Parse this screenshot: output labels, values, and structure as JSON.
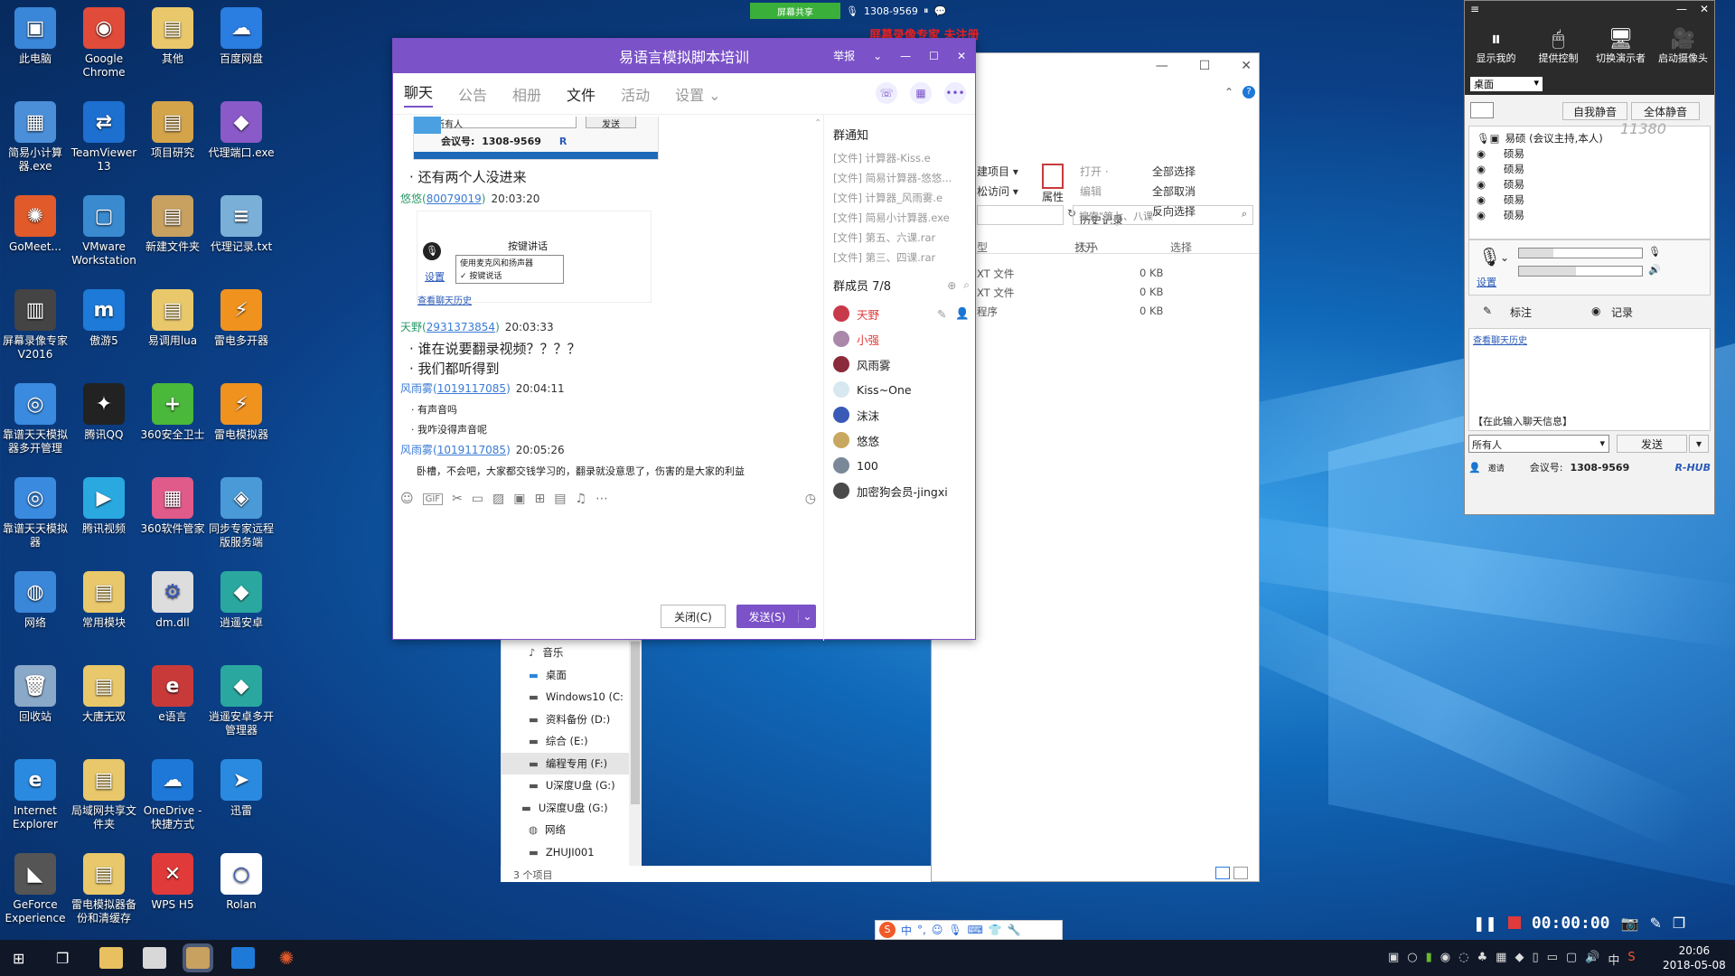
{
  "desktop": {
    "icons": [
      {
        "label": "此电脑",
        "color": "#3a86d8",
        "glyph": "▣"
      },
      {
        "label": "Google Chrome",
        "color": "#e04b3a",
        "glyph": "◉"
      },
      {
        "label": "其他",
        "color": "#e8c86a",
        "glyph": "▤"
      },
      {
        "label": "百度网盘",
        "color": "#2a7de1",
        "glyph": "☁"
      },
      {
        "label": "简易小计算器.exe",
        "color": "#4a8fd8",
        "glyph": "▦"
      },
      {
        "label": "TeamViewer 13",
        "color": "#1d6fd0",
        "glyph": "⇄"
      },
      {
        "label": "项目研究",
        "color": "#d4a44a",
        "glyph": "▤"
      },
      {
        "label": "代理端口.exe",
        "color": "#8a5ac8",
        "glyph": "◆"
      },
      {
        "label": "GoMeet...",
        "color": "#e05a2a",
        "glyph": "✺"
      },
      {
        "label": "VMware Workstation",
        "color": "#3a8ad0",
        "glyph": "▢"
      },
      {
        "label": "新建文件夹",
        "color": "#c8a060",
        "glyph": "▤"
      },
      {
        "label": "代理记录.txt",
        "color": "#7ab0d8",
        "glyph": "≡"
      },
      {
        "label": "屏幕录像专家V2016",
        "color": "#444",
        "glyph": "▥"
      },
      {
        "label": "傲游5",
        "color": "#1e7ad8",
        "glyph": "m"
      },
      {
        "label": "易调用lua",
        "color": "#e8c86a",
        "glyph": "▤"
      },
      {
        "label": "雷电多开器",
        "color": "#f0921e",
        "glyph": "⚡"
      },
      {
        "label": "靠谱天天模拟器多开管理",
        "color": "#3a8ae0",
        "glyph": "◎"
      },
      {
        "label": "腾讯QQ",
        "color": "#222",
        "glyph": "✦"
      },
      {
        "label": "360安全卫士",
        "color": "#4ab83a",
        "glyph": "+"
      },
      {
        "label": "雷电模拟器",
        "color": "#f0921e",
        "glyph": "⚡"
      },
      {
        "label": "靠谱天天模拟器",
        "color": "#3a8ae0",
        "glyph": "◎"
      },
      {
        "label": "腾讯视频",
        "color": "#2aa8e0",
        "glyph": "▶"
      },
      {
        "label": "360软件管家",
        "color": "#e05a8a",
        "glyph": "▦"
      },
      {
        "label": "同步专家远程版服务端",
        "color": "#4a9ad8",
        "glyph": "◈"
      },
      {
        "label": "网络",
        "color": "#3a86d8",
        "glyph": "◍"
      },
      {
        "label": "常用模块",
        "color": "#e8c86a",
        "glyph": "▤"
      },
      {
        "label": "dm.dll",
        "color": "#ddd",
        "glyph": "⚙"
      },
      {
        "label": "逍遥安卓",
        "color": "#2aa8a0",
        "glyph": "◆"
      },
      {
        "label": "回收站",
        "color": "#8aa8c8",
        "glyph": "🗑"
      },
      {
        "label": "大唐无双",
        "color": "#e8c86a",
        "glyph": "▤"
      },
      {
        "label": "e语言",
        "color": "#c83a3a",
        "glyph": "e"
      },
      {
        "label": "逍遥安卓多开管理器",
        "color": "#2aa8a0",
        "glyph": "◆"
      },
      {
        "label": "Internet Explorer",
        "color": "#2a8ae0",
        "glyph": "e"
      },
      {
        "label": "局域网共享文件夹",
        "color": "#e8c86a",
        "glyph": "▤"
      },
      {
        "label": "OneDrive - 快捷方式",
        "color": "#1e78d8",
        "glyph": "☁"
      },
      {
        "label": "迅雷",
        "color": "#2a8ae0",
        "glyph": "➤"
      },
      {
        "label": "GeForce Experience",
        "color": "#555",
        "glyph": "◣"
      },
      {
        "label": "雷电模拟器备份和清缓存",
        "color": "#e8c86a",
        "glyph": "▤"
      },
      {
        "label": "WPS H5",
        "color": "#e03a3a",
        "glyph": "✕"
      },
      {
        "label": "Rolan",
        "color": "#fff",
        "glyph": "○"
      }
    ]
  },
  "recorder_bar": {
    "status": "屏幕共享",
    "meeting_id": "1308-9569",
    "watermark": "屏幕录像专家 未注册"
  },
  "chat": {
    "title": "易语言模拟脚本培训",
    "title_actions": {
      "report": "举报"
    },
    "tabs": [
      "聊天",
      "公告",
      "相册",
      "文件",
      "活动",
      "设置"
    ],
    "active_tab": "聊天",
    "embedded_bar": {
      "audience": "所有人",
      "send": "发送",
      "meeting_label": "会议号:",
      "meeting_id": "1308-9569",
      "r": "R"
    },
    "messages": [
      {
        "type": "text",
        "text": "· 还有两个人没进来"
      },
      {
        "type": "header",
        "name": "悠悠",
        "id": "80079019",
        "time": "20:03:20"
      },
      {
        "type": "image",
        "title": "按键讲话",
        "opt1": "使用麦克风和扬声器",
        "opt2": "按键说话",
        "link": "设置",
        "history": "查看聊天历史"
      },
      {
        "type": "header",
        "name": "天野",
        "id": "2931373854",
        "time": "20:03:33"
      },
      {
        "type": "text",
        "text": "· 谁在说要翻录视频？？？？"
      },
      {
        "type": "text",
        "text": "· 我们都听得到"
      },
      {
        "type": "header",
        "name": "风雨雾",
        "id": "1019117085",
        "time": "20:04:11"
      },
      {
        "type": "small",
        "text": "· 有声音吗"
      },
      {
        "type": "small",
        "text": "· 我咋没得声音呢"
      },
      {
        "type": "header",
        "name": "风雨雾",
        "id": "1019117085",
        "time": "20:05:26"
      },
      {
        "type": "small",
        "text": "卧槽，不会吧，大家都交钱学习的，翻录就没意思了，伤害的是大家的利益"
      }
    ],
    "close_btn": "关闭(C)",
    "send_btn": "发送(S)",
    "notice": {
      "title": "群通知",
      "items": [
        "[文件] 计算器-Kiss.e",
        "[文件] 简易计算器-悠悠...",
        "[文件] 计算器_风雨雾.e",
        "[文件] 简易小计算器.exe",
        "[文件] 第五、六课.rar",
        "[文件] 第三、四课.rar"
      ]
    },
    "members": {
      "title": "群成员 7/8",
      "list": [
        {
          "name": "天野",
          "color": "#e03a3a",
          "av": "#c83a4a"
        },
        {
          "name": "小强",
          "color": "#e03a3a",
          "av": "#aa88aa"
        },
        {
          "name": "风雨雾",
          "color": "#222",
          "av": "#8a2a3a"
        },
        {
          "name": "Kiss~One",
          "color": "#222",
          "av": "#d8e8f0"
        },
        {
          "name": "沫沫",
          "color": "#222",
          "av": "#3a5ab8"
        },
        {
          "name": "悠悠",
          "color": "#222",
          "av": "#c8a860"
        },
        {
          "name": "100",
          "color": "#222",
          "av": "#7a8898"
        },
        {
          "name": "加密狗会员-jingxi",
          "color": "#222",
          "av": "#4a4a4a"
        }
      ]
    }
  },
  "explorer": {
    "ribbon": {
      "new_item": "建项目 ▾",
      "easy_access": "松访问 ▾",
      "properties": "属性",
      "open": "打开 ·",
      "edit": "编辑",
      "history": "历史记录",
      "open_group": "打开",
      "select_all": "全部选择",
      "select_none": "全部取消",
      "invert": "反向选择",
      "select_group": "选择"
    },
    "search_placeholder": "搜索\"第七、八课\"",
    "columns": [
      "型",
      "大小"
    ],
    "rows": [
      {
        "type": "XT 文件",
        "size": "0 KB"
      },
      {
        "type": "XT 文件",
        "size": "0 KB"
      },
      {
        "type": "程序",
        "size": "0 KB"
      }
    ],
    "nav": [
      "音乐",
      "桌面",
      "Windows10 (C:",
      "资料备份 (D:)",
      "综合 (E:)",
      "编程专用 (F:)",
      "U深度U盘 (G:)",
      "U深度U盘 (G:)",
      "网络",
      "ZHUJI001"
    ],
    "status": "3 个项目"
  },
  "meeting_panel": {
    "toolbar": [
      "显示我的",
      "提供控制",
      "切换演示者",
      "启动摄像头"
    ],
    "desktop_select": "桌面",
    "mute_self": "自我静音",
    "mute_all": "全体静音",
    "participants": [
      "易硕 (会议主持,本人)",
      "硕易",
      "硕易",
      "硕易",
      "硕易",
      "硕易"
    ],
    "handwriting": "11380",
    "settings_link": "设置",
    "mark": "标注",
    "record": "记录",
    "history_link": "查看聊天历史",
    "input_hint": "【在此输入聊天信息】",
    "audience": "所有人",
    "send": "发送",
    "invite": "邀请",
    "meeting_label": "会议号:",
    "meeting_id": "1308-9569",
    "brand": "R-HUB"
  },
  "recorder_controls": {
    "timer": "00:00:00"
  },
  "ime": {
    "lang": "中"
  },
  "taskbar": {
    "time": "20:06",
    "date": "2018-05-08",
    "lang": "中"
  }
}
